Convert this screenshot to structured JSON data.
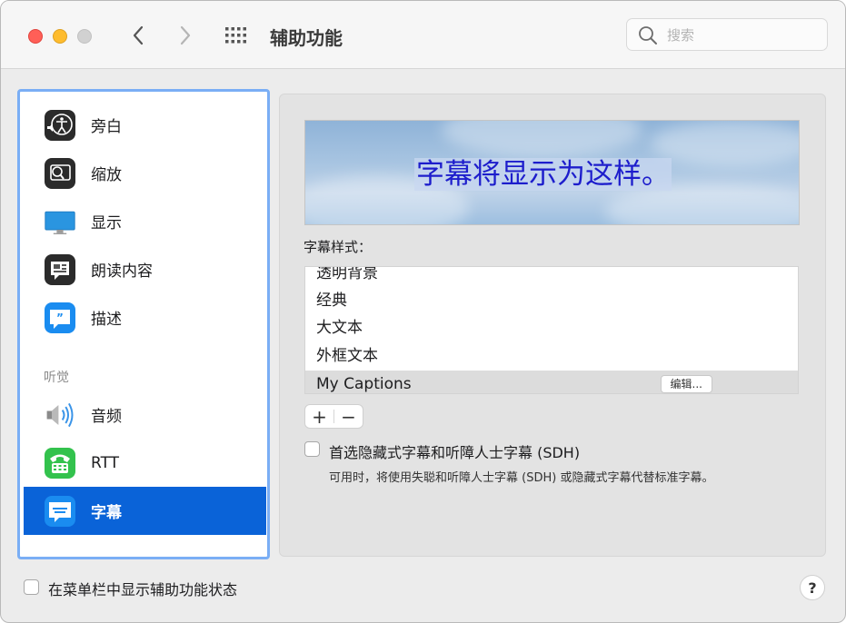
{
  "window": {
    "title": "辅助功能"
  },
  "search": {
    "placeholder": "搜索"
  },
  "sidebar": {
    "items": [
      {
        "label": "旁白",
        "icon": "voiceover-icon"
      },
      {
        "label": "缩放",
        "icon": "zoom-icon"
      },
      {
        "label": "显示",
        "icon": "display-icon"
      },
      {
        "label": "朗读内容",
        "icon": "spoken-content-icon"
      },
      {
        "label": "描述",
        "icon": "descriptions-icon"
      },
      {
        "label": "音频",
        "icon": "speaker-icon"
      },
      {
        "label": "RTT",
        "icon": "rtt-icon"
      },
      {
        "label": "字幕",
        "icon": "captions-icon",
        "selected": true
      }
    ],
    "section_hearing": "听觉"
  },
  "main": {
    "preview_text": "字幕将显示为这样。",
    "style_label": "字幕样式：",
    "styles": [
      "透明背景",
      "经典",
      "大文本",
      "外框文本",
      "My Captions"
    ],
    "selected_style": "My Captions",
    "edit_label": "编辑...",
    "add_label": "+",
    "remove_label": "−",
    "sdh_label": "首选隐藏式字幕和听障人士字幕 (SDH)",
    "sdh_checked": false,
    "sdh_description": "可用时，将使用失聪和听障人士字幕 (SDH) 或隐藏式字幕代替标准字幕。"
  },
  "footer": {
    "menubar_label": "在菜单栏中显示辅助功能状态",
    "menubar_checked": false,
    "help_label": "?"
  },
  "colors": {
    "accent": "#0a63d8",
    "sidebar_focus": "#7aaef5",
    "preview_text": "#1d1dcc"
  }
}
